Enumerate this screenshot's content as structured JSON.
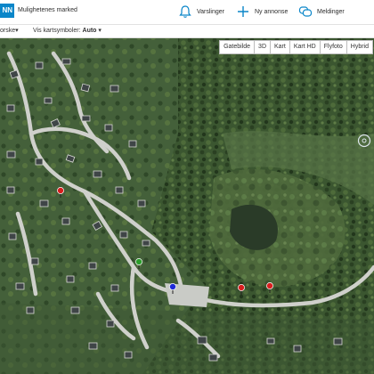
{
  "header": {
    "logo_text": "NN",
    "brand": "Mulighetenes marked",
    "nav": [
      {
        "label": "Varslinger",
        "icon": "bell-icon"
      },
      {
        "label": "Ny annonse",
        "icon": "plus-icon"
      },
      {
        "label": "Meldinger",
        "icon": "chat-icon"
      }
    ]
  },
  "subbar": {
    "left_label": "orske",
    "left_caret": "▾",
    "symbol_prefix": "Vis kartsymboler:",
    "symbol_value": "Auto",
    "symbol_caret": "▾"
  },
  "map": {
    "tabs": [
      "Gatebilde",
      "3D",
      "Kart",
      "Kart HD",
      "Flyfoto",
      "Hybrid"
    ],
    "active_tab": "Flyfoto",
    "markers": [
      {
        "color": "#d81e1e",
        "icon": "map-pin-icon"
      },
      {
        "color": "#2a9d2a",
        "icon": "map-pin-icon"
      },
      {
        "color": "#1e2ad8",
        "icon": "map-pin-icon"
      },
      {
        "color": "#d81e1e",
        "icon": "map-pin-icon"
      },
      {
        "color": "#d81e1e",
        "icon": "map-pin-icon"
      }
    ]
  },
  "colors": {
    "brand": "#0a86c9",
    "vegetation_dark": "#2f4a2b",
    "vegetation_light": "#5d7a45",
    "road": "#d9d9d6"
  }
}
